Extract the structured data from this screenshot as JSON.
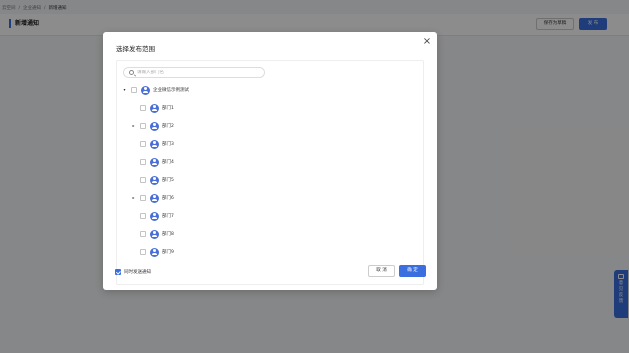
{
  "breadcrumb": [
    "云空间",
    "企业通知",
    "新增通知"
  ],
  "breadcrumb_sep": "/",
  "header": {
    "title": "新增通知",
    "save_draft_label": "保存为草稿",
    "publish_label": "发 布"
  },
  "feedback": {
    "label": "意见反馈"
  },
  "modal": {
    "title": "选择发布范围",
    "close_glyph": "×",
    "search_placeholder": "请输入部门名",
    "tree": [
      {
        "label": "企业微信示例测试",
        "expanded": true,
        "has_children": true,
        "level": 0
      },
      {
        "label": "部门1",
        "has_children": false,
        "level": 1
      },
      {
        "label": "部门2",
        "has_children": true,
        "level": 1
      },
      {
        "label": "部门3",
        "has_children": false,
        "level": 1
      },
      {
        "label": "部门4",
        "has_children": false,
        "level": 1
      },
      {
        "label": "部门5",
        "has_children": false,
        "level": 1
      },
      {
        "label": "部门6",
        "has_children": true,
        "level": 1
      },
      {
        "label": "部门7",
        "has_children": false,
        "level": 1
      },
      {
        "label": "部门8",
        "has_children": false,
        "level": 1
      },
      {
        "label": "部门9",
        "has_children": false,
        "level": 1
      }
    ],
    "notify_label": "同时发送通知",
    "notify_checked": true,
    "cancel_label": "取 消",
    "ok_label": "确 定"
  },
  "colors": {
    "primary": "#3b6fe0",
    "avatar": "#4a6fd6"
  }
}
